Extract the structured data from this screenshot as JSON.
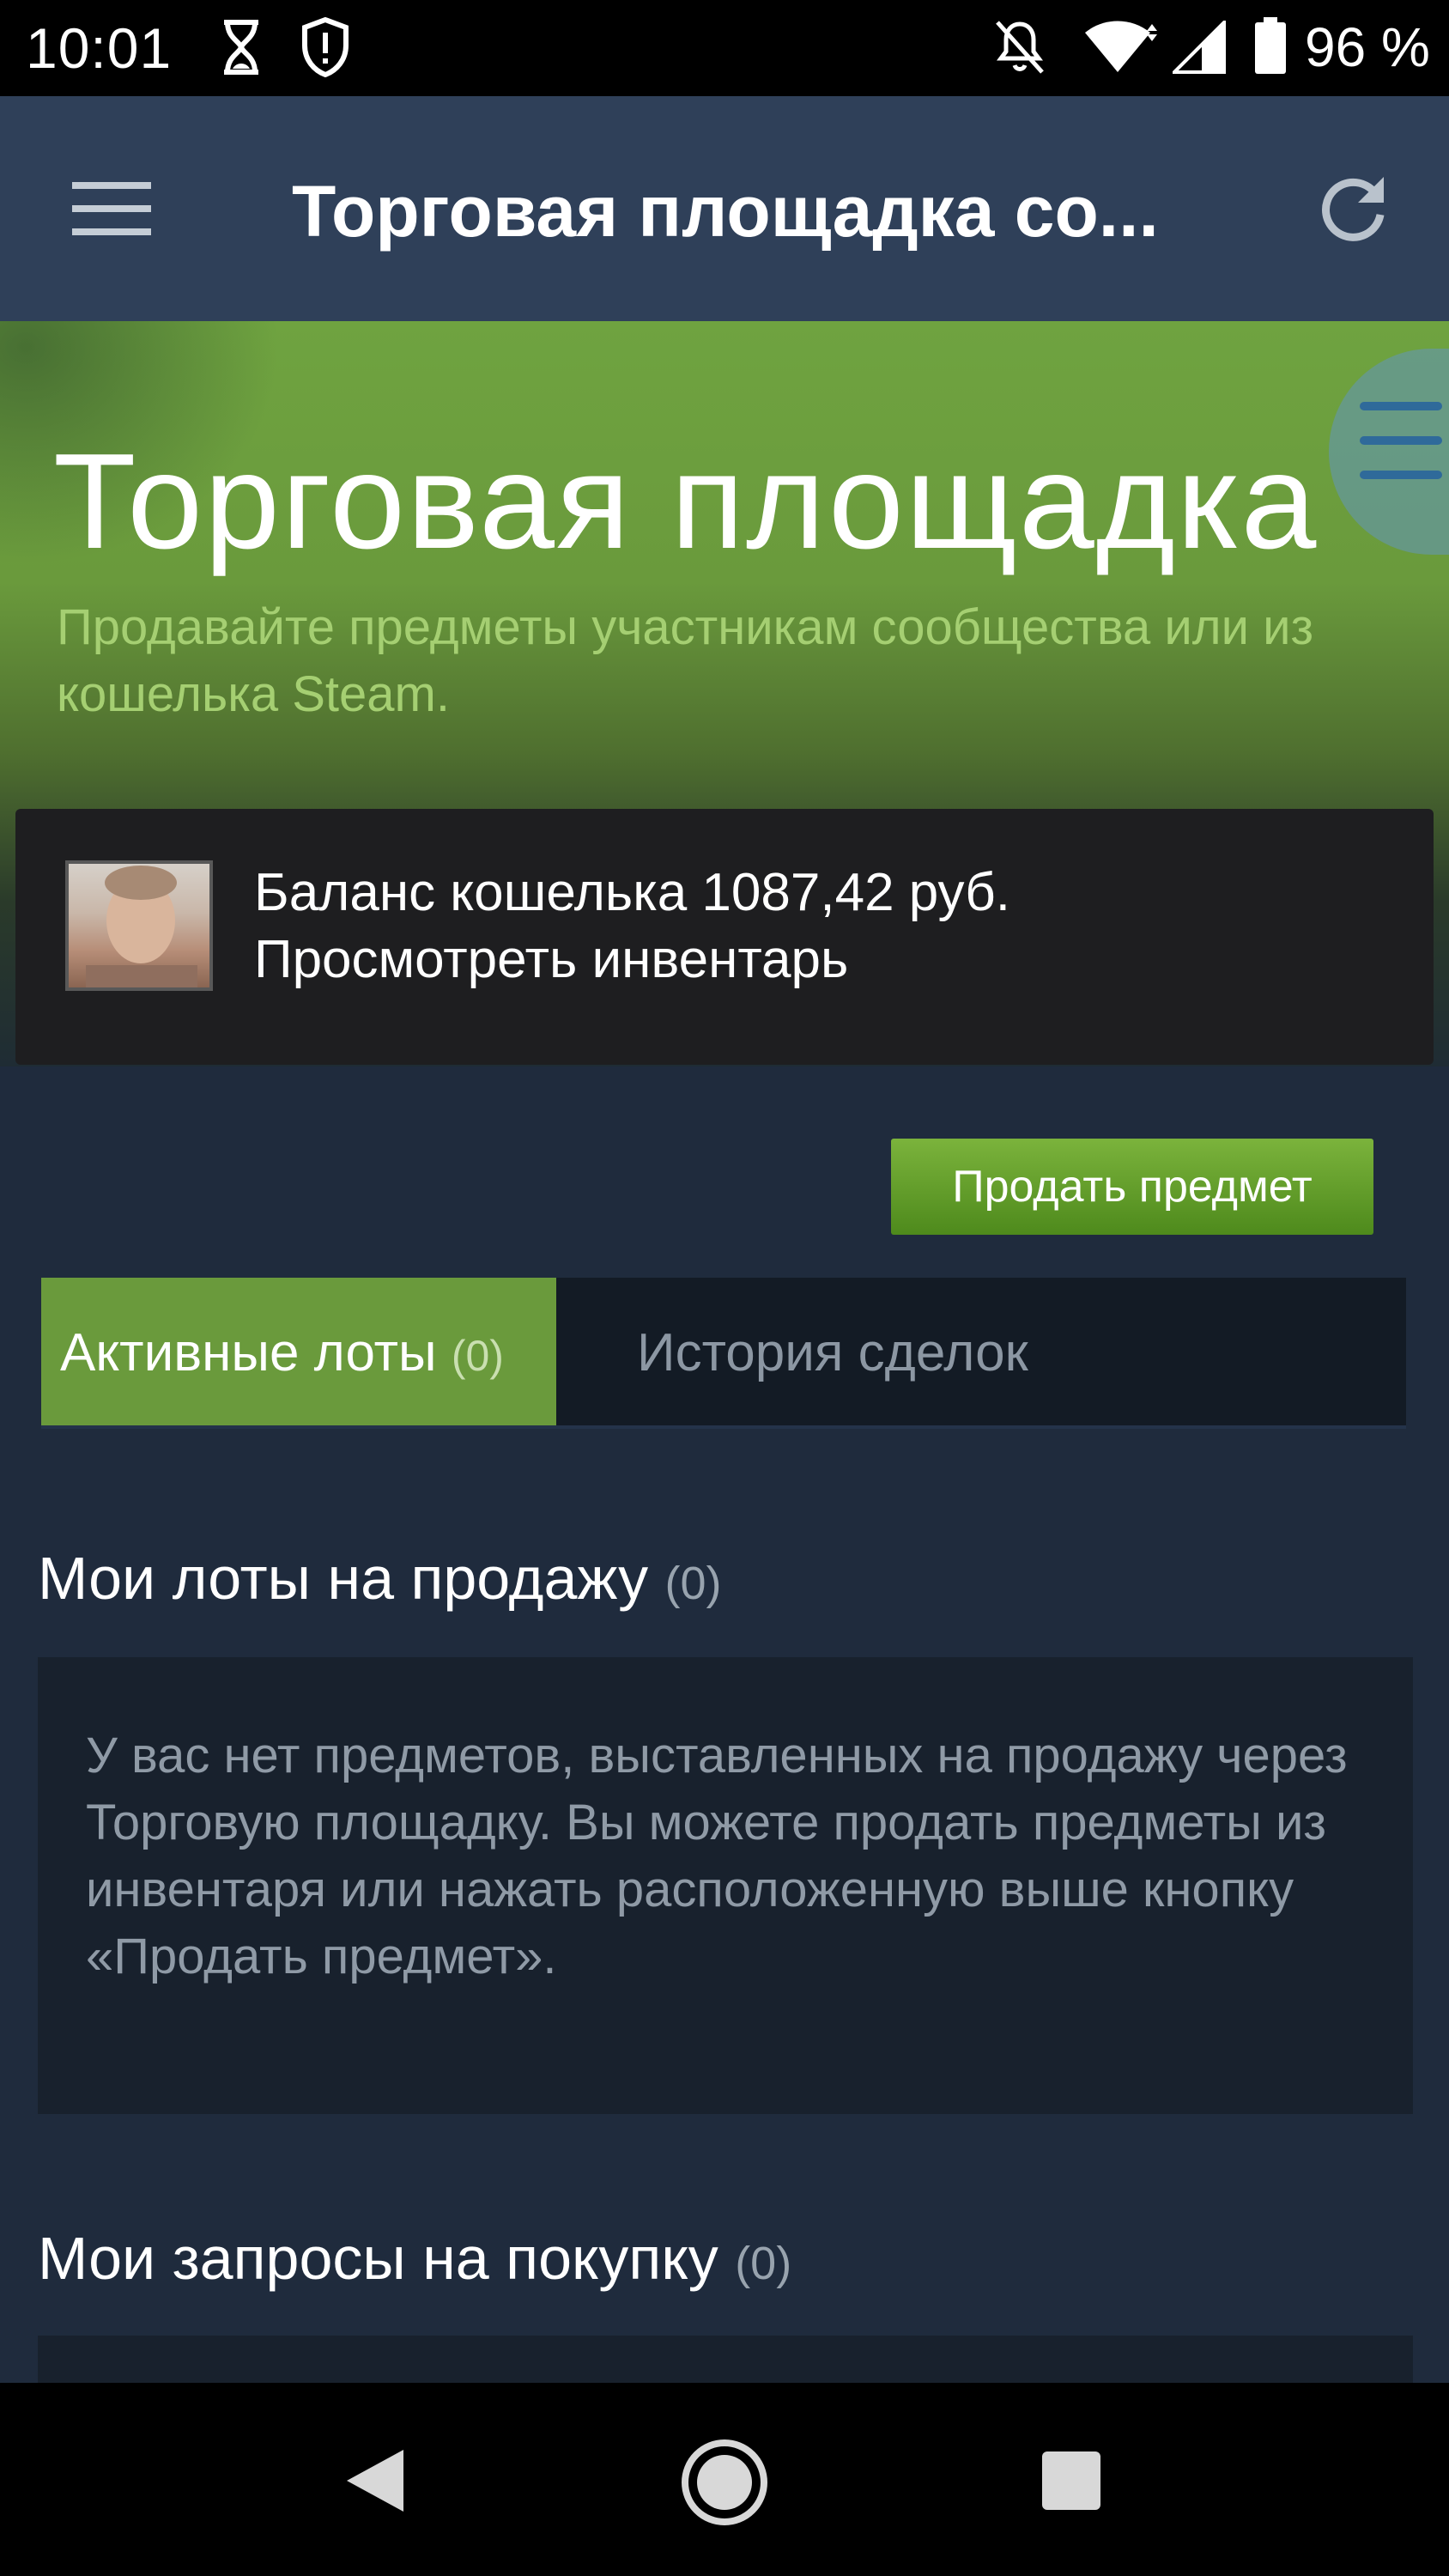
{
  "status_bar": {
    "time": "10:01",
    "battery_percent": "96 %",
    "icons": [
      "hourglass-icon",
      "shield-alert-icon",
      "notifications-off-icon",
      "wifi-icon",
      "signal-icon",
      "battery-icon"
    ]
  },
  "app_bar": {
    "title": "Торговая площадка со...",
    "icons": [
      "menu-icon",
      "refresh-icon"
    ]
  },
  "hero": {
    "title": "Торговая площадка",
    "subtitle": "Продавайте предметы участникам сообщества или из кошелька Steam."
  },
  "wallet": {
    "balance": "Баланс кошелька 1087,42 руб.",
    "inventory_link": "Просмотреть инвентарь"
  },
  "actions": {
    "sell_button": "Продать предмет"
  },
  "tabs": {
    "active_label": "Активные лоты",
    "active_count": "(0)",
    "history_label": "История сделок"
  },
  "sections": {
    "listings_title": "Мои лоты на продажу",
    "listings_count": "(0)",
    "listings_empty": "У вас нет предметов, выставленных на продажу через Торговую площадку. Вы можете продать предметы из инвентаря или нажать расположенную выше кнопку «Продать предмет».",
    "buy_orders_title": "Мои запросы на покупку",
    "buy_orders_count": "(0)"
  },
  "colors": {
    "app_bar": "#2f4059",
    "accent_green": "#6a9a3c",
    "main_bg": "#1f2b3d",
    "subtitle_green": "#a5cf72"
  }
}
